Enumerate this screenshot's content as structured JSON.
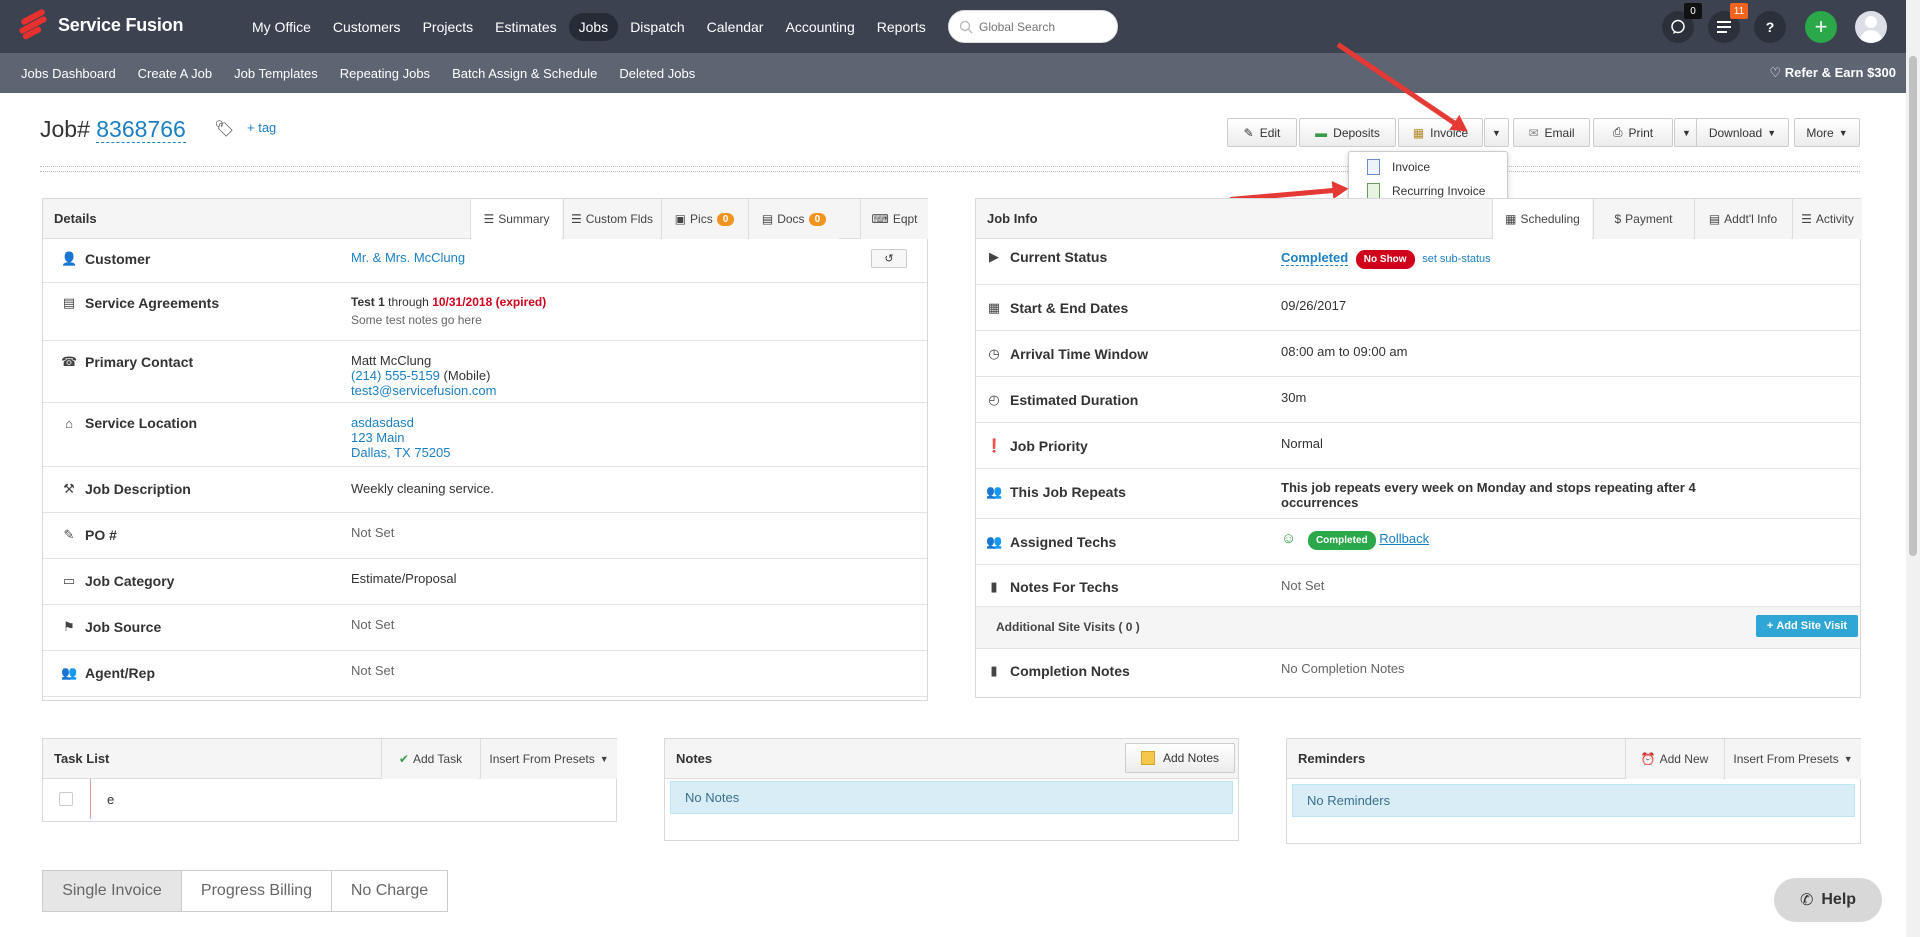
{
  "app": {
    "brand": "Service Fusion"
  },
  "nav": {
    "items": [
      "My Office",
      "Customers",
      "Projects",
      "Estimates",
      "Jobs",
      "Dispatch",
      "Calendar",
      "Accounting",
      "Reports"
    ],
    "active": "Jobs"
  },
  "search": {
    "placeholder": "Global Search"
  },
  "header_badges": {
    "chat": "0",
    "notifications": "11",
    "help": "?",
    "add": "+"
  },
  "subnav": {
    "items": [
      "Jobs Dashboard",
      "Create A Job",
      "Job Templates",
      "Repeating Jobs",
      "Batch Assign & Schedule",
      "Deleted Jobs"
    ],
    "refer": "Refer & Earn $300"
  },
  "job": {
    "label": "Job#",
    "number": "8368766",
    "add_tag": "+ tag"
  },
  "actions": {
    "edit": "Edit",
    "deposits": "Deposits",
    "invoice": "Invoice",
    "email": "Email",
    "print": "Print",
    "download": "Download",
    "more": "More"
  },
  "invoice_menu": {
    "items": [
      "Invoice",
      "Recurring Invoice"
    ]
  },
  "details": {
    "title": "Details",
    "tabs": {
      "summary": "Summary",
      "custom": "Custom Flds",
      "pics": "Pics",
      "pics_count": "0",
      "docs": "Docs",
      "docs_count": "0",
      "eqpt": "Eqpt"
    },
    "customer": {
      "label": "Customer",
      "value": "Mr. & Mrs. McClung"
    },
    "agreements": {
      "label": "Service Agreements",
      "name": "Test 1",
      "through": "through",
      "date": "10/31/2018 (expired)",
      "notes": "Some test notes go here"
    },
    "contact": {
      "label": "Primary Contact",
      "name": "Matt McClung",
      "phone": "(214) 555-5159",
      "phone_type": "(Mobile)",
      "email": "test3@servicefusion.com"
    },
    "location": {
      "label": "Service Location",
      "line1": "asdasdasd",
      "line2": "123 Main",
      "line3": "Dallas, TX 75205"
    },
    "description": {
      "label": "Job Description",
      "value": "Weekly cleaning service."
    },
    "po": {
      "label": "PO #",
      "value": "Not Set"
    },
    "category": {
      "label": "Job Category",
      "value": "Estimate/Proposal"
    },
    "source": {
      "label": "Job Source",
      "value": "Not Set"
    },
    "agent": {
      "label": "Agent/Rep",
      "value": "Not Set"
    }
  },
  "jobinfo": {
    "title": "Job Info",
    "tabs": {
      "scheduling": "Scheduling",
      "payment": "Payment",
      "addtl": "Addt'l Info",
      "activity": "Activity"
    },
    "status": {
      "label": "Current Status",
      "value": "Completed",
      "badge": "No Show",
      "sub": "set sub-status"
    },
    "dates": {
      "label": "Start & End Dates",
      "value": "09/26/2017"
    },
    "arrival": {
      "label": "Arrival Time Window",
      "value": "08:00 am to 09:00 am"
    },
    "duration": {
      "label": "Estimated Duration",
      "value": "30m"
    },
    "priority": {
      "label": "Job Priority",
      "value": "Normal"
    },
    "repeats": {
      "label": "This Job Repeats",
      "value_line1": "This job repeats every week on Monday and stops repeating after 4",
      "value_line2": "occurrences"
    },
    "techs": {
      "label": "Assigned Techs",
      "badge": "Completed",
      "rollback": "Rollback"
    },
    "notes_techs": {
      "label": "Notes For Techs",
      "value": "Not Set"
    },
    "site_visits": {
      "label": "Additional Site Visits ( 0 )",
      "button": "Add Site Visit"
    },
    "completion": {
      "label": "Completion Notes",
      "value": "No Completion Notes"
    }
  },
  "tasks": {
    "title": "Task List",
    "add": "Add Task",
    "presets": "Insert From Presets",
    "item": "e"
  },
  "notes": {
    "title": "Notes",
    "add": "Add Notes",
    "empty": "No Notes"
  },
  "reminders": {
    "title": "Reminders",
    "add": "Add New",
    "presets": "Insert From Presets",
    "empty": "No Reminders"
  },
  "billing_tabs": [
    "Single Invoice",
    "Progress Billing",
    "No Charge"
  ],
  "help": {
    "label": "Help"
  },
  "colors": {
    "nav": "#3c4250",
    "subnav": "#5d6472",
    "link": "#1a7fc3",
    "accent_red": "#e53935",
    "green": "#2aa84a",
    "orange_badge": "#f0941f"
  }
}
